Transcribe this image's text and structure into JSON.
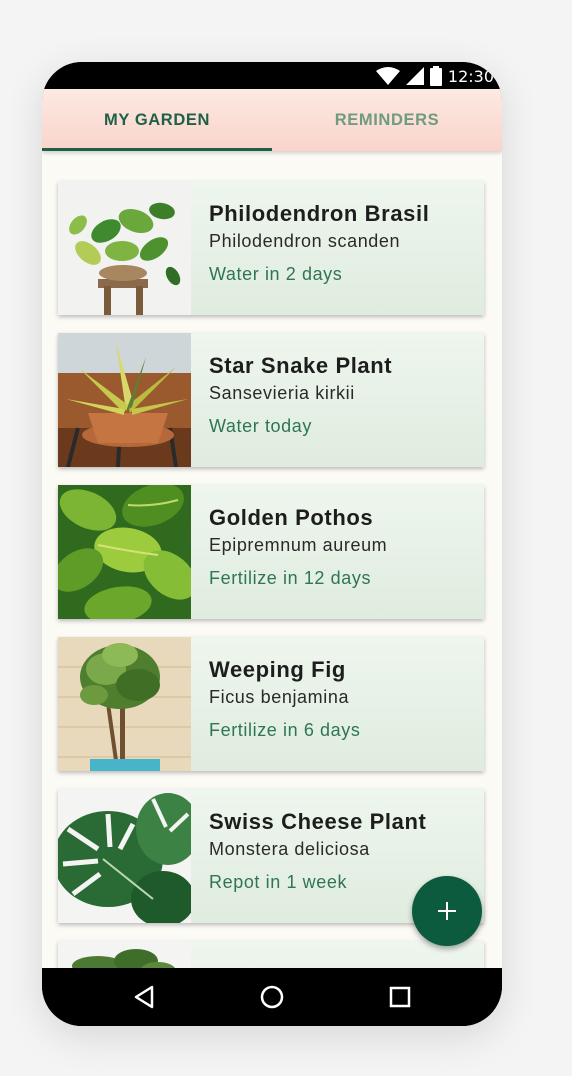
{
  "status_bar": {
    "time": "12:30"
  },
  "tabs": [
    {
      "label": "MY GARDEN",
      "active": true
    },
    {
      "label": "REMINDERS",
      "active": false
    }
  ],
  "plants": [
    {
      "name": "Philodendron Brasil",
      "scientific": "Philodendron scanden",
      "task": "Water in 2 days",
      "image": "philodendron-photo"
    },
    {
      "name": "Star Snake Plant",
      "scientific": "Sansevieria kirkii",
      "task": "Water today",
      "image": "snake-plant-photo"
    },
    {
      "name": "Golden Pothos",
      "scientific": "Epipremnum aureum",
      "task": "Fertilize in 12 days",
      "image": "pothos-photo"
    },
    {
      "name": "Weeping Fig",
      "scientific": "Ficus benjamina",
      "task": "Fertilize in 6 days",
      "image": "weeping-fig-photo"
    },
    {
      "name": "Swiss Cheese Plant",
      "scientific": "Monstera deliciosa",
      "task": "Repot in 1 week",
      "image": "monstera-photo"
    }
  ],
  "fab": {
    "icon": "plus-icon"
  },
  "nav_bar": {
    "icons": [
      "back-icon",
      "home-icon",
      "recents-icon"
    ]
  },
  "colors": {
    "primary": "#1f6147",
    "fab": "#0d5b3f",
    "tab_bar": "#f9d4cb",
    "task_text": "#2f7553",
    "card_bg": "#e6f1e5"
  }
}
